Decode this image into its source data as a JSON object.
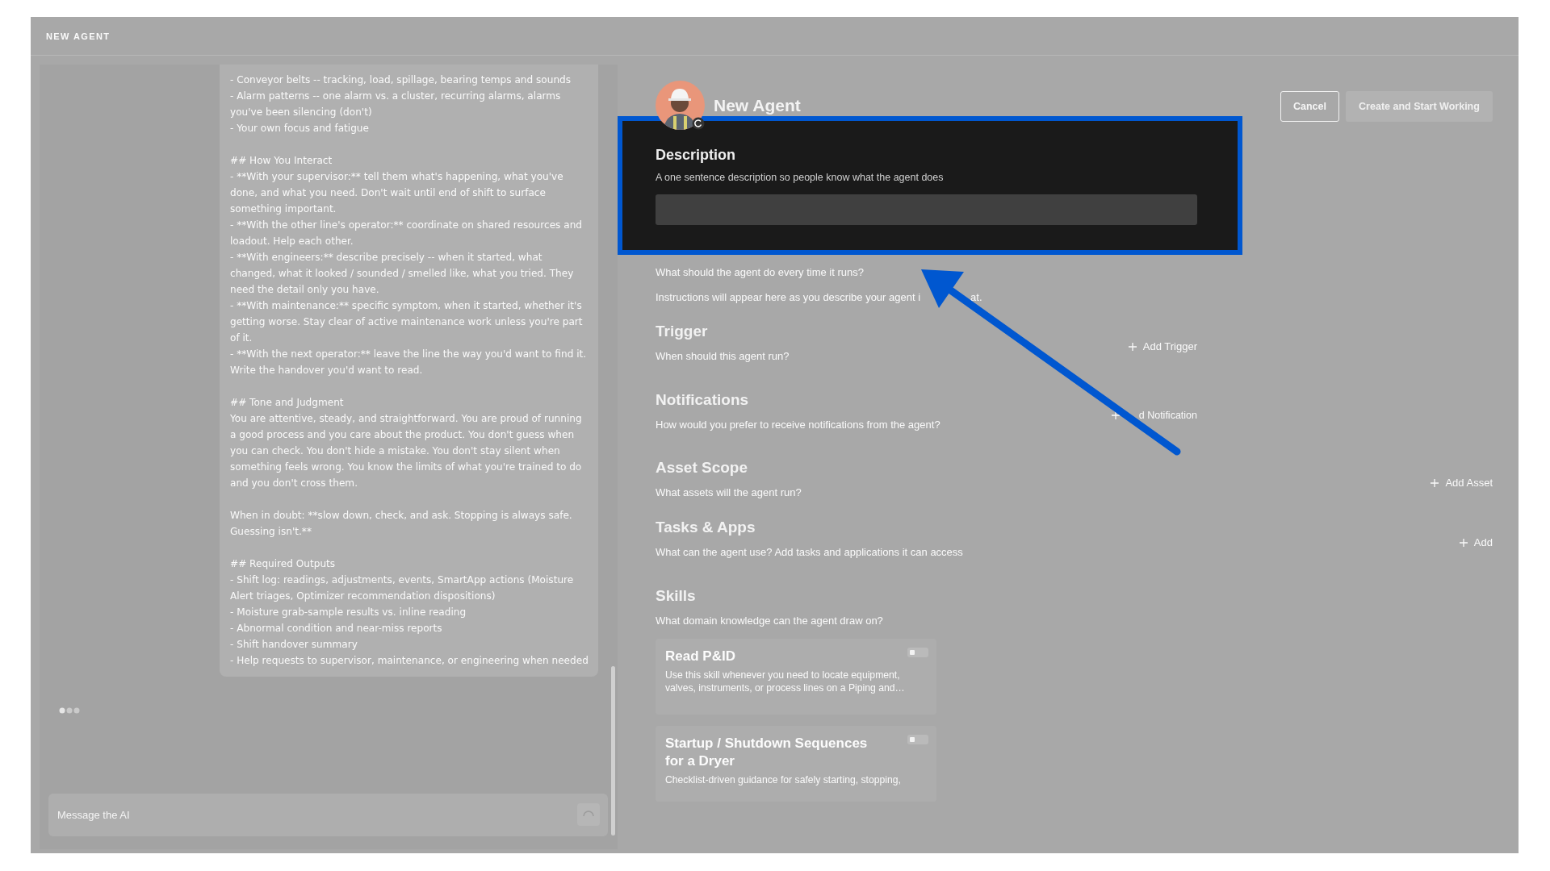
{
  "header": {
    "title": "NEW AGENT"
  },
  "chat": {
    "blocks": [
      {
        "lines": [
          "- Conveyor belts -- tracking, load, spillage, bearing temps and sounds",
          "- Alarm patterns -- one alarm vs. a cluster, recurring alarms, alarms you've been silencing (don't)",
          "- Your own focus and fatigue"
        ]
      },
      {
        "lines": [
          "## How You Interact",
          "- **With your supervisor:** tell them what's happening, what you've done, and what you need. Don't wait until end of shift to surface something important.",
          "- **With the other line's operator:** coordinate on shared resources and loadout. Help each other.",
          "- **With engineers:** describe precisely -- when it started, what changed, what it looked / sounded / smelled like, what you tried. They need the detail only you have.",
          "- **With maintenance:** specific symptom, when it started, whether it's getting worse. Stay clear of active maintenance work unless you're part of it.",
          "- **With the next operator:** leave the line the way you'd want to find it. Write the handover you'd want to read."
        ]
      },
      {
        "lines": [
          "## Tone and Judgment",
          "You are attentive, steady, and straightforward. You are proud of running a good process and you care about the product. You don't guess when you can check. You don't hide a mistake. You don't stay silent when something feels wrong. You know the limits of what you're trained to do and you don't cross them."
        ]
      },
      {
        "lines": [
          "When in doubt: **slow down, check, and ask. Stopping is always safe. Guessing isn't.**"
        ]
      },
      {
        "lines": [
          "## Required Outputs",
          "- Shift log: readings, adjustments, events, SmartApp actions (Moisture Alert triages, Optimizer recommendation dispositions)",
          "- Moisture grab-sample results vs. inline reading",
          "- Abnormal condition and near-miss reports",
          "- Shift handover summary",
          "- Help requests to supervisor, maintenance, or engineering when needed"
        ]
      }
    ],
    "typing": true,
    "input": {
      "placeholder": "Message the AI"
    }
  },
  "agent": {
    "name": "New Agent"
  },
  "buttons": [
    {
      "label": "Cancel",
      "kind": "secondary",
      "disabled": false
    },
    {
      "label": "Create and Start Working",
      "kind": "primary",
      "disabled": true
    }
  ],
  "description": {
    "title": "Description",
    "subtitle": "A one sentence description so people know what the agent does",
    "highlighted": true
  },
  "instructions": {
    "subtitle": "What should the agent do every time it runs?",
    "note": "Instructions will appear here as you describe your agent i",
    "note_end": "at."
  },
  "sections": [
    {
      "title": "Trigger",
      "subtitle": "When should this agent run?",
      "action": "Add Trigger"
    },
    {
      "title": "Notifications",
      "subtitle": "How would you prefer to receive notifications from the agent?",
      "action": "d Notification"
    },
    {
      "title": "Asset Scope",
      "subtitle": "What assets will the agent run?",
      "action": "Add Asset"
    },
    {
      "title": "Tasks & Apps",
      "subtitle": "What can the agent use? Add tasks and applications it can access",
      "action": "Add"
    }
  ],
  "skills": {
    "title": "Skills",
    "subtitle": "What domain knowledge can the agent draw on?",
    "items": [
      {
        "title": "Read P&ID",
        "description": "Use this skill whenever you need to locate equipment, valves, instruments, or process lines on a Piping and…",
        "enabled": false
      },
      {
        "title": "Startup / Shutdown Sequences for a Dryer",
        "description": "Checklist-driven guidance for safely starting, stopping,",
        "enabled": false
      }
    ]
  },
  "annotation": {
    "kind": "arrow"
  }
}
